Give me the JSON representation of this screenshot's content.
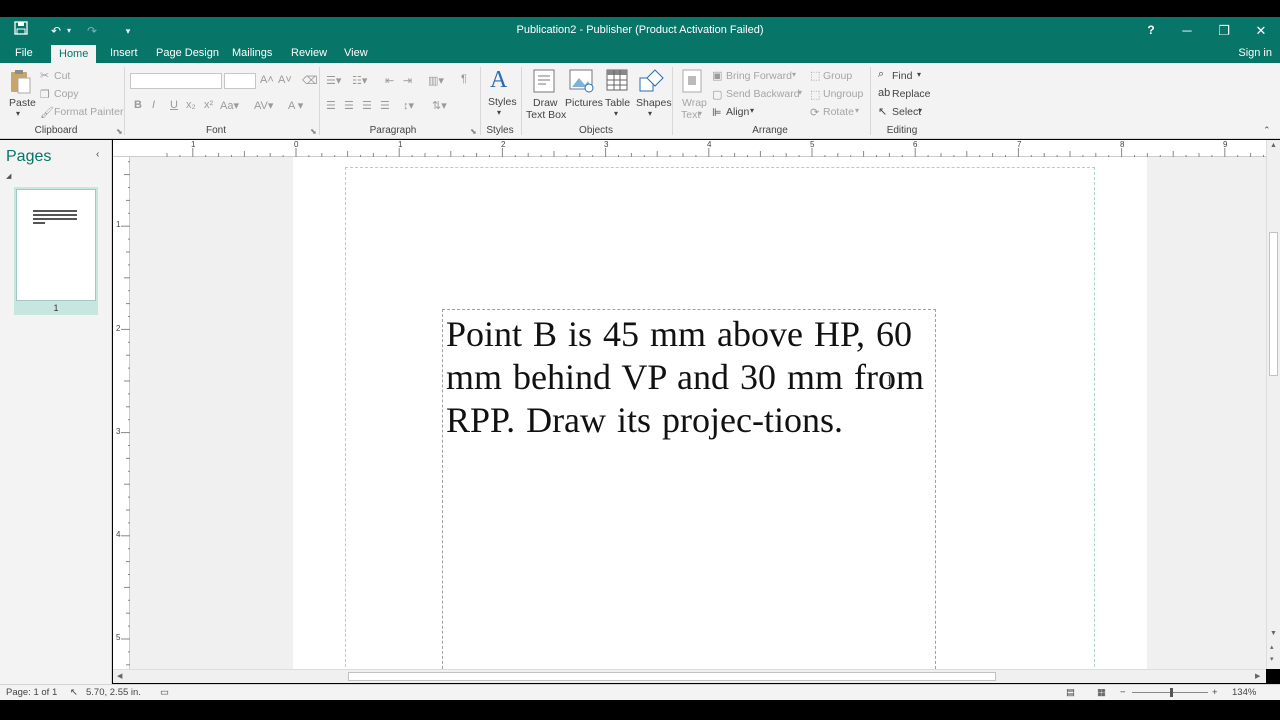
{
  "window": {
    "title": "Publication2 - Publisher (Product Activation Failed)",
    "help": "?",
    "minimize": "─",
    "restore": "❐",
    "close": "✕"
  },
  "quick_access": {
    "save": "💾",
    "undo": "↶",
    "redo": "↷",
    "customize": "▾"
  },
  "tabs": [
    {
      "label": "File",
      "active": false
    },
    {
      "label": "Home",
      "active": true
    },
    {
      "label": "Insert",
      "active": false
    },
    {
      "label": "Page Design",
      "active": false
    },
    {
      "label": "Mailings",
      "active": false
    },
    {
      "label": "Review",
      "active": false
    },
    {
      "label": "View",
      "active": false
    }
  ],
  "sign_in": "Sign in",
  "ribbon": {
    "clipboard": {
      "label": "Clipboard",
      "paste": "Paste",
      "cut": "Cut",
      "copy": "Copy",
      "format_painter": "Format Painter"
    },
    "font": {
      "label": "Font"
    },
    "paragraph": {
      "label": "Paragraph"
    },
    "styles": {
      "label": "Styles",
      "styles_button": "Styles"
    },
    "objects": {
      "label": "Objects",
      "draw_text_box_1": "Draw",
      "draw_text_box_2": "Text Box",
      "pictures": "Pictures",
      "table": "Table",
      "shapes": "Shapes"
    },
    "arrange": {
      "label": "Arrange",
      "wrap_text_1": "Wrap",
      "wrap_text_2": "Text",
      "bring_forward": "Bring Forward",
      "send_backward": "Send Backward",
      "align": "Align",
      "group": "Group",
      "ungroup": "Ungroup",
      "rotate": "Rotate"
    },
    "editing": {
      "label": "Editing",
      "find": "Find",
      "replace": "Replace",
      "select": "Select"
    }
  },
  "pages_pane": {
    "title": "Pages",
    "thumbnail_page_number": "1"
  },
  "document": {
    "text": "Point B is 45 mm above HP, 60 mm behind VP and 30 mm from RPP. Draw its projec-tions."
  },
  "rulers": {
    "horizontal": [
      "1",
      "0",
      "1",
      "2",
      "3",
      "4",
      "5",
      "6",
      "7",
      "8",
      "9"
    ],
    "vertical": [
      "1",
      "2",
      "3",
      "4",
      "5"
    ]
  },
  "status": {
    "page": "Page: 1 of 1",
    "position": "5.70, 2.55 in.",
    "zoom": "134%",
    "zoom_out": "−",
    "zoom_in": "+"
  },
  "colors": {
    "accent": "#077568",
    "ribbon_bg": "#f3f3f3"
  }
}
